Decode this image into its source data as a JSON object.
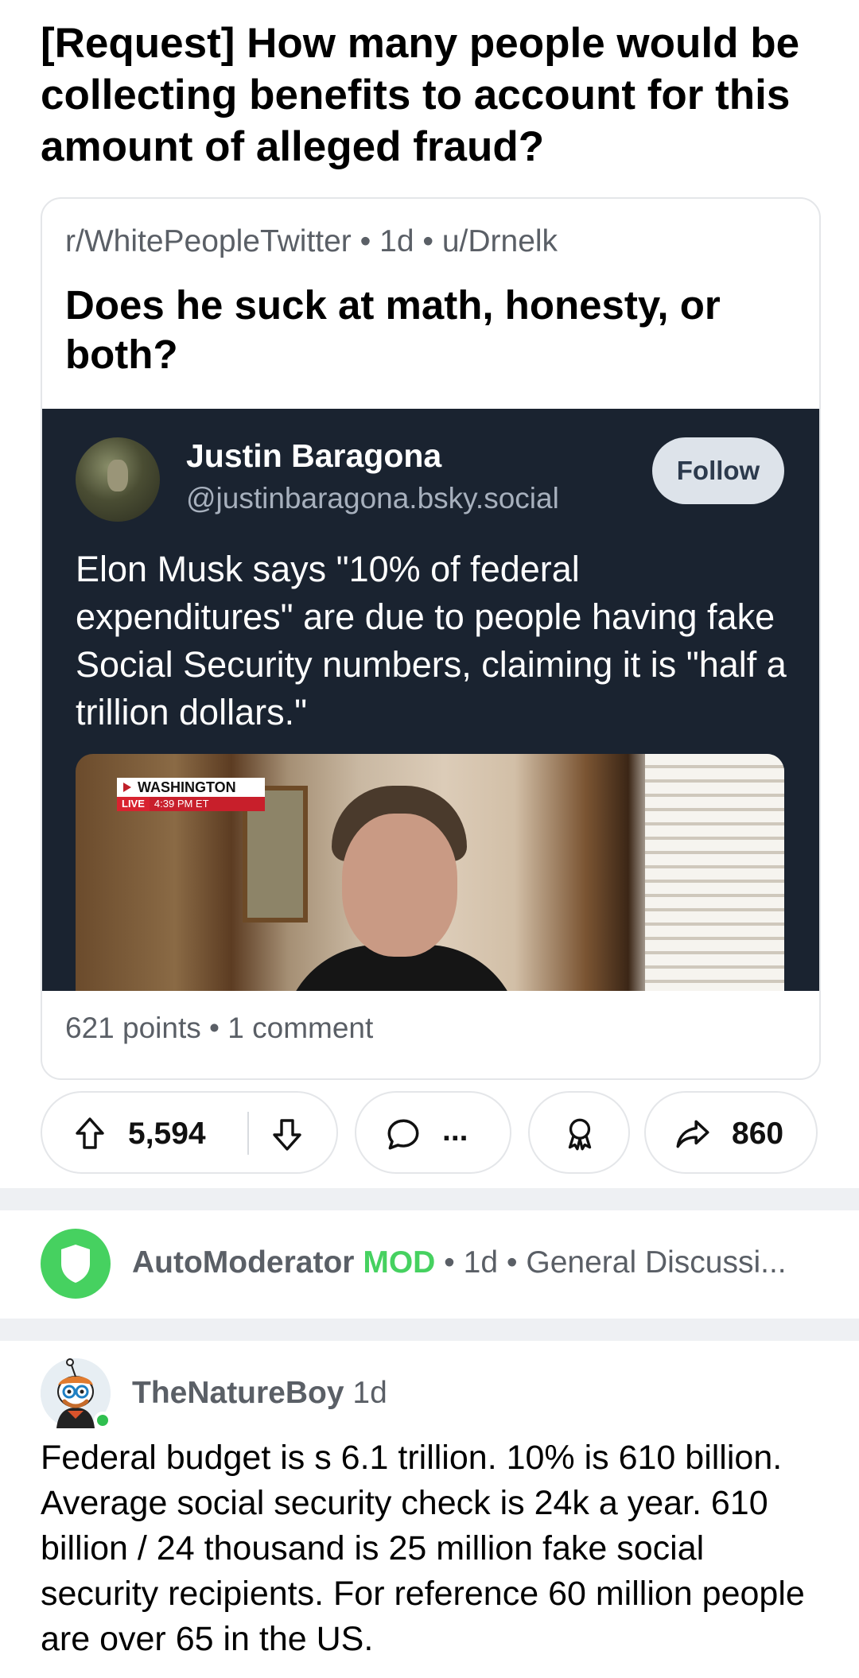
{
  "post": {
    "title": "[Request] How many people would be collecting benefits to account for this amount of alleged fraud?"
  },
  "crosspost": {
    "meta": "r/WhitePeopleTwitter • 1d • u/Drnelk",
    "title": "Does he suck at math, honesty, or both?",
    "stats": "621 points • 1 comment",
    "tweet": {
      "name": "Justin Baragona",
      "handle": "@justinbaragona.bsky.social",
      "follow_label": "Follow",
      "text": "Elon Musk says \"10% of federal expenditures\" are due to people having fake Social Security numbers, claiming it is \"half a trillion dollars.\"",
      "media_badge": {
        "location": "WASHINGTON",
        "live": "LIVE",
        "time": "4:39 PM ET"
      }
    }
  },
  "actions": {
    "upvotes": "5,594",
    "comments": "...",
    "shares": "860",
    "icons": [
      "upvote-icon",
      "downvote-icon",
      "comment-icon",
      "award-icon",
      "share-icon"
    ]
  },
  "automod": {
    "name": "AutoModerator",
    "flag": "MOD",
    "rest": " • 1d • General Discussi..."
  },
  "comment": {
    "author": "TheNatureBoy",
    "age": "1d",
    "body": "Federal budget is s 6.1 trillion. 10% is 610 billion. Average social security check is 24k a year. 610 billion / 24 thousand is 25 million fake social security recipients. For reference 60 million people are over 65 in the US."
  },
  "colors": {
    "mod_green": "#46d160",
    "tweet_bg": "#1a2330",
    "meta_gray": "#5a5f66"
  }
}
